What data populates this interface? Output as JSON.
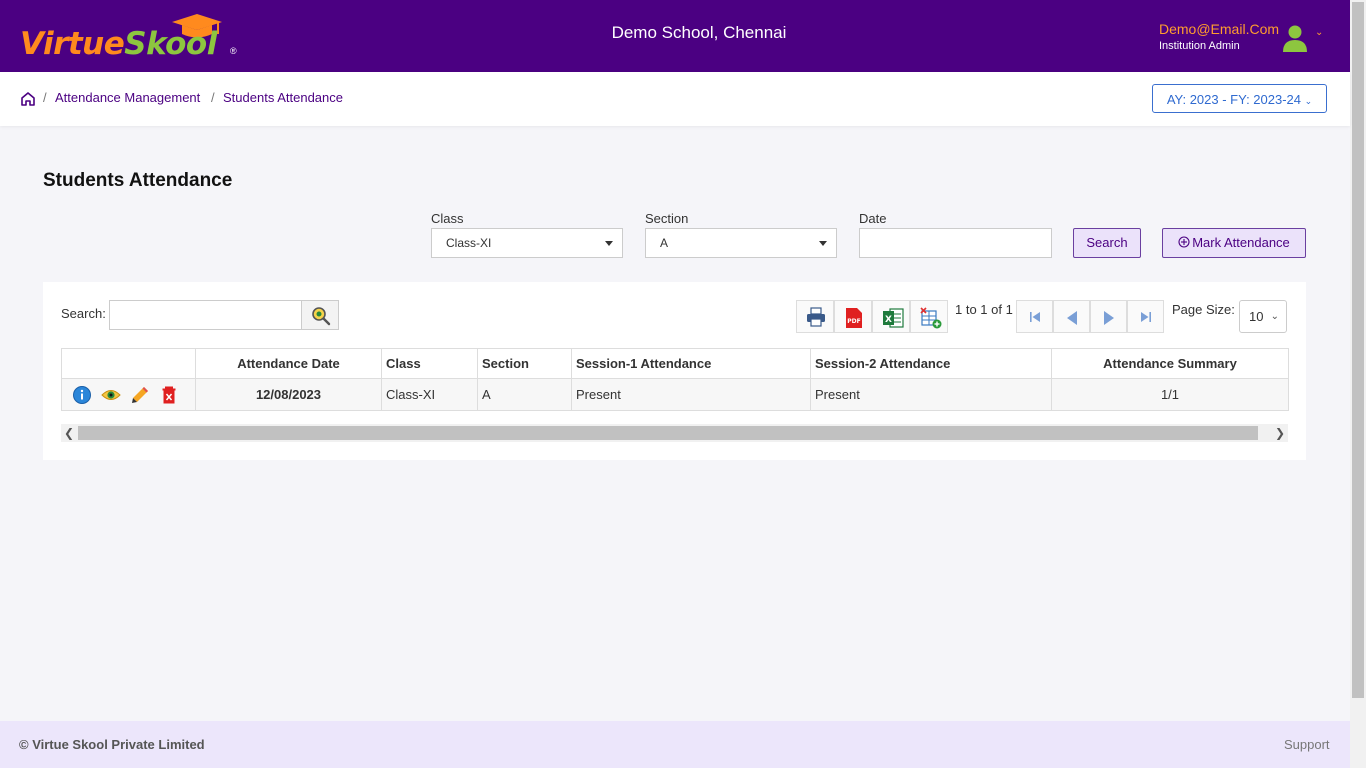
{
  "brand": {
    "logo_part1": "Virtue",
    "logo_part2": "Skool",
    "logo_reg": "®",
    "colors": {
      "header": "#4b0082",
      "orange": "#ff8a1e",
      "green": "#8dc63f"
    }
  },
  "header": {
    "school_name": "Demo School, Chennai",
    "user_email": "Demo@Email.Com",
    "user_role": "Institution Admin",
    "avatar_icon": "user-icon"
  },
  "breadcrumb": {
    "home_icon": "home-icon",
    "separator": "/",
    "items": [
      "Attendance Management",
      "Students Attendance"
    ]
  },
  "academic_year": {
    "label": "AY: 2023 - FY: 2023-24"
  },
  "page": {
    "title": "Students Attendance"
  },
  "filters": {
    "class_label": "Class",
    "class_value": "Class-XI",
    "section_label": "Section",
    "section_value": "A",
    "date_label": "Date",
    "date_value": "",
    "search_button": "Search",
    "mark_button": "Mark Attendance"
  },
  "grid": {
    "search_label": "Search:",
    "search_value": "",
    "toolbar_icons": [
      "print-icon",
      "pdf-icon",
      "excel-icon",
      "add-columns-icon"
    ],
    "page_info": "1 to 1 of 1",
    "page_size_label": "Page Size:",
    "page_size": "10",
    "columns": [
      "",
      "Attendance Date",
      "Class",
      "Section",
      "Session-1 Attendance",
      "Session-2 Attendance",
      "Attendance Summary"
    ],
    "rows": [
      {
        "actions": [
          "info-icon",
          "view-icon",
          "edit-icon",
          "delete-icon"
        ],
        "attendance_date": "12/08/2023",
        "class": "Class-XI",
        "section": "A",
        "session1": "Present",
        "session2": "Present",
        "summary": "1/1"
      }
    ]
  },
  "footer": {
    "copyright": "© Virtue Skool Private Limited",
    "support": "Support"
  }
}
